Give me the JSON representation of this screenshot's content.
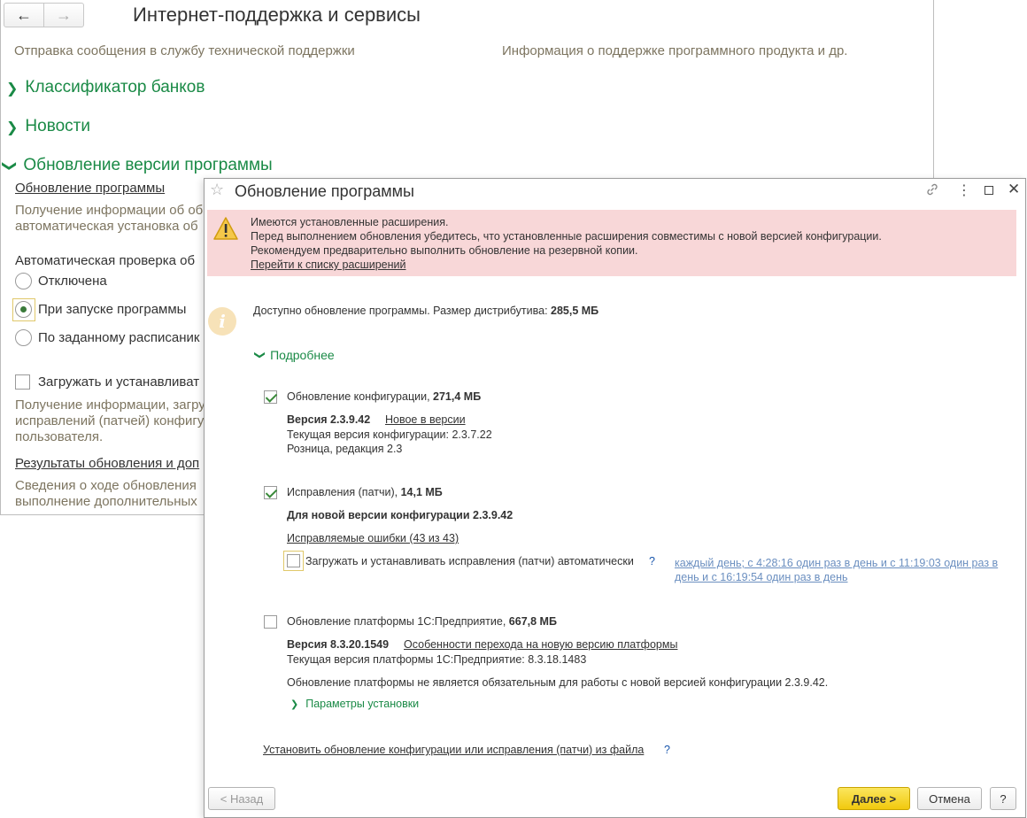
{
  "background_window": {
    "title": "Интернет-поддержка и сервисы",
    "desc_left": "Отправка сообщения в службу технической поддержки",
    "desc_right": "Информация о поддержке программного продукта и др.",
    "sections": [
      "Классификатор банков",
      "Новости",
      "Обновление версии программы"
    ],
    "update_link": "Обновление программы",
    "update_desc": [
      "Получение информации об об",
      "автоматическая установка об"
    ],
    "auto_check_label": "Автоматическая проверка об",
    "radios": [
      "Отключена",
      "При запуске программы",
      "По заданному расписаник"
    ],
    "selected_radio": "При запуске программы",
    "download_checkbox": "Загружать и устанавливат",
    "download_desc": [
      "Получение информации, загру",
      "исправлений (патчей) конфигу",
      "пользователя."
    ],
    "results_link": "Результаты обновления и доп",
    "results_desc": [
      "Сведения о ходе обновления",
      "выполнение дополнительных"
    ]
  },
  "dialog": {
    "title": "Обновление программы",
    "warning": {
      "line1": "Имеются установленные расширения.",
      "line2": "Перед выполнением обновления убедитесь, что установленные расширения совместимы с новой версией конфигурации.",
      "line3": "Рекомендуем предварительно выполнить обновление на резервной копии.",
      "link": "Перейти к списку расширений"
    },
    "info_text": "Доступно обновление программы. Размер дистрибутива: ",
    "info_size": "285,5 МБ",
    "details_label": "Подробнее",
    "config_update": {
      "label": "Обновление конфигурации, ",
      "size": "271,4 МБ",
      "checked": true,
      "version": "Версия 2.3.9.42",
      "new_link": "Новое в версии",
      "current": "Текущая версия конфигурации: 2.3.7.22",
      "edition": "Розница, редакция 2.3"
    },
    "patches": {
      "label": "Исправления (патчи), ",
      "size": "14,1 МБ",
      "checked": true,
      "for_version": "Для новой версии конфигурации 2.3.9.42",
      "errors_link": "Исправляемые ошибки (43 из 43)",
      "auto_label": "Загружать и устанавливать исправления (патчи) автоматически",
      "auto_checked": false,
      "help": "?",
      "schedule": [
        "каждый день; с 4:28:16 один раз в день и с 11:19:03 один раз в",
        "день и с 16:19:54 один раз в день"
      ]
    },
    "platform": {
      "label": "Обновление платформы 1С:Предприятие, ",
      "size": "667,8 МБ",
      "checked": false,
      "version": "Версия 8.3.20.1549",
      "features_link": "Особенности перехода на новую версию платформы",
      "current": "Текущая версия платформы 1С:Предприятие: 8.3.18.1483",
      "note": "Обновление платформы не является обязательным для работы с новой версией конфигурации 2.3.9.42.",
      "params_label": "Параметры установки"
    },
    "install_from_file_link": "Установить обновление конфигурации или исправления (патчи) из файла",
    "install_help": "?",
    "buttons": {
      "back": "< Назад",
      "next": "Далее >",
      "cancel": "Отмена",
      "help": "?"
    }
  }
}
